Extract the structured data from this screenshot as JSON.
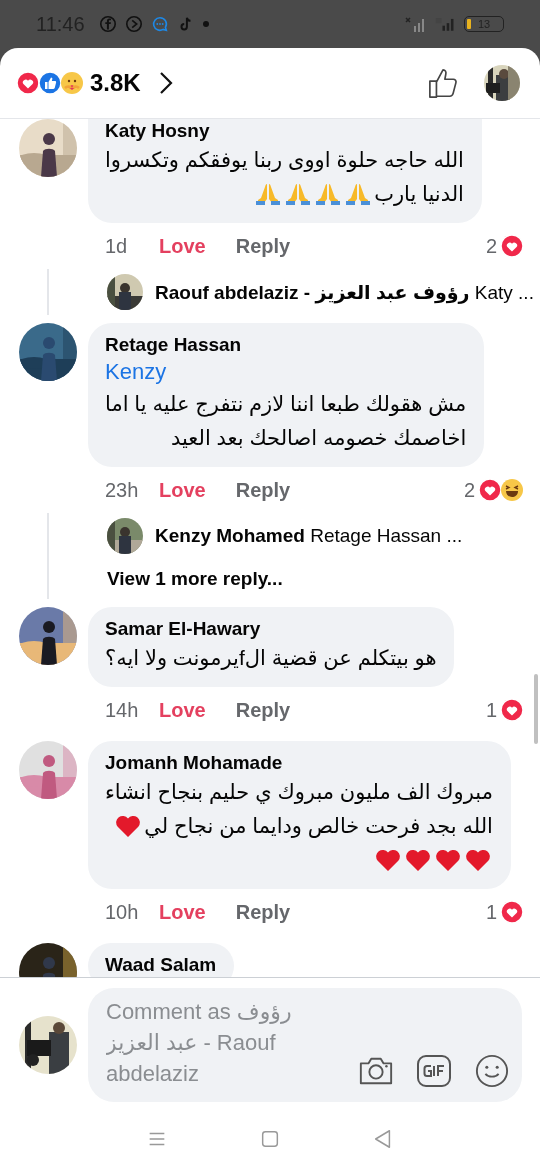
{
  "status_bar": {
    "time": "11:46",
    "battery": "13"
  },
  "header": {
    "reactions": [
      {
        "kind": "love"
      },
      {
        "kind": "like"
      },
      {
        "kind": "care"
      }
    ],
    "reaction_count": "3.8K"
  },
  "comments": [
    {
      "author": "Katy Hosny",
      "lines": [
        {
          "text": "الله حاجه حلوة اووى ربنا يوفقكم وتكسروا"
        },
        {
          "text": "الدنيا يارب",
          "emoji": [
            {
              "kind": "pray"
            },
            {
              "kind": "pray"
            },
            {
              "kind": "pray"
            },
            {
              "kind": "pray"
            }
          ]
        }
      ],
      "time": "1d",
      "reaction_label": "Love",
      "reacted": true,
      "reply_label": "Reply",
      "reaction_count": "2",
      "reactions": [
        {
          "kind": "love"
        }
      ],
      "replies": [
        {
          "author": "Raouf abdelaziz - رؤوف عبد العزيز",
          "preview": "Katy ..."
        }
      ]
    },
    {
      "author": "Retage Hassan",
      "mention": "Kenzy",
      "lines": [
        {
          "text": "مش هقولك طبعا اننا لازم نتفرج عليه يا اما"
        },
        {
          "text": "اخاصمك خصومه اصالحك بعد العيد"
        }
      ],
      "time": "23h",
      "reaction_label": "Love",
      "reacted": true,
      "reply_label": "Reply",
      "reaction_count": "2",
      "reactions": [
        {
          "kind": "love"
        },
        {
          "kind": "haha"
        }
      ],
      "replies": [
        {
          "author": "Kenzy Mohamed",
          "preview": "Retage Hassan ..."
        }
      ],
      "more_replies": "View 1 more reply..."
    },
    {
      "author": "Samar El-Hawary",
      "lines": [
        {
          "text": "هو بيتكلم عن قضية الfيرمونت ولا ايه؟"
        }
      ],
      "time": "14h",
      "reaction_label": "Love",
      "reacted": true,
      "reply_label": "Reply",
      "reaction_count": "1",
      "reactions": [
        {
          "kind": "love"
        }
      ]
    },
    {
      "author": "Jomanh Mohamade",
      "lines": [
        {
          "text": "مبروك الف مليون مبروك ي حليم بنجاح انشاء"
        },
        {
          "text": "الله بجد فرحت خالص ودايما من نجاح لي",
          "emoji": [
            {
              "kind": "heart"
            }
          ]
        },
        {
          "emoji": [
            {
              "kind": "heart"
            },
            {
              "kind": "heart"
            },
            {
              "kind": "heart"
            },
            {
              "kind": "heart"
            }
          ]
        }
      ],
      "time": "10h",
      "reaction_label": "Love",
      "reacted": true,
      "reply_label": "Reply",
      "reaction_count": "1",
      "reactions": [
        {
          "kind": "love"
        }
      ]
    },
    {
      "author": "Waad Salam"
    }
  ],
  "composer": {
    "placeholder": "Comment as رؤوف عبد العزيز - Raouf abdelaziz"
  }
}
